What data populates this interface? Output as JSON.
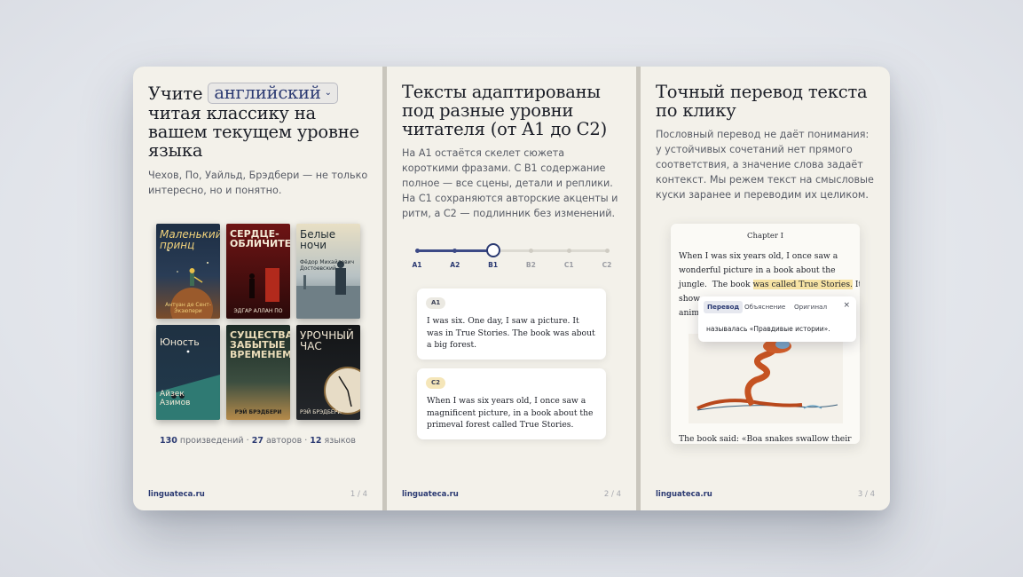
{
  "panel1": {
    "title_pre": "Учите",
    "language_select": "английский",
    "title_rest": "читая классику на вашем текущем уровне языка",
    "lead": "Чехов, По, Уайльд, Брэдбери — не только интересно, но и понятно.",
    "covers": [
      {
        "title": "Маленький принц",
        "author": "Антуан де Сент-Экзюпери"
      },
      {
        "title": "СЕРДЦЕ-ОБЛИЧИТЕЛЬ",
        "author": "ЭДГАР АЛЛАН ПО"
      },
      {
        "title": "Белые ночи",
        "author": "Фёдор Михайлович Достоевский"
      },
      {
        "title": "Юность",
        "author": "Айзек Азимов"
      },
      {
        "title": "СУЩЕСТВА ЗАБЫТЫЕ ВРЕМЕНЕМ",
        "author": "РЭЙ БРЭДБЕРИ"
      },
      {
        "title": "УРОЧНЫЙ ЧАС",
        "author": "РЭЙ БРЭДБЕРИ"
      }
    ],
    "stats": {
      "works_count": "130",
      "works_label": "произведений",
      "sep": "·",
      "authors_count": "27",
      "authors_label": "авторов",
      "langs_count": "12",
      "langs_label": "языков"
    },
    "site": "linguateca.ru",
    "page": "1 / 4"
  },
  "panel2": {
    "title": "Тексты адаптированы под разные уровни читателя (от A1 до C2)",
    "lead": "На A1 остаётся скелет сюжета короткими фразами. С B1 содержание полное — все сцены, детали и реплики. На C1 сохраняются авторские акценты и ритм, а C2 — подлинник без изменений.",
    "levels": [
      "A1",
      "A2",
      "B1",
      "B2",
      "C1",
      "C2"
    ],
    "selected_level": "B1",
    "level_position": 0.4,
    "card_a1": {
      "badge": "A1",
      "text": "I was six. One day, I saw a picture. It was in True Stories. The book was about a big forest."
    },
    "card_c2": {
      "badge": "C2",
      "text": "When I was six years old, I once saw a magnificent picture, in a book about the primeval forest called True Stories."
    },
    "site": "linguateca.ru",
    "page": "2 / 4"
  },
  "panel3": {
    "title": "Точный перевод текста по клику",
    "lead": "Пословный перевод не даёт понимания: у устойчивых сочетаний нет прямого соответствия, а значение слова задаёт контекст. Мы режем текст на смысловые куски заранее и переводим их целиком.",
    "reader": {
      "chapter": "Chapter I",
      "line1": "When I was six years old, I once saw a",
      "line2": "wonderful picture in a book about the",
      "line3_pre": "jungle.  The book ",
      "line3_hl": "was called True Stories.",
      "line3_post": " It",
      "line4": "show",
      "line5": "anim",
      "bottom": "The book said: «Boa snakes swallow their"
    },
    "popup": {
      "tabs": [
        "Перевод",
        "Объяснение",
        "Оригинал"
      ],
      "active_tab": "Перевод",
      "close": "×",
      "translation": "называлась «Правдивые истории»."
    },
    "site": "linguateca.ru",
    "page": "3 / 4"
  },
  "colors": {
    "accent": "#2b3a72",
    "panel_bg": "#f3f1ea",
    "highlight": "#f7e3a4"
  }
}
